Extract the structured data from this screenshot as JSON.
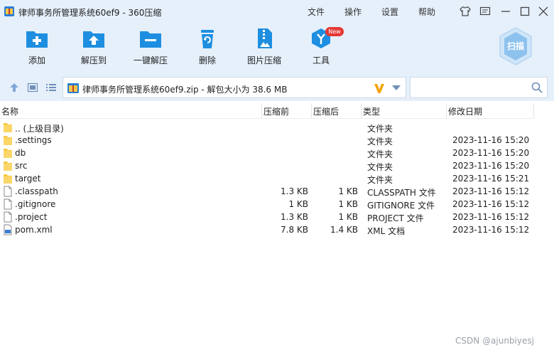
{
  "window": {
    "title": "律师事务所管理系统60ef9 - 360压缩",
    "menu": [
      "文件",
      "操作",
      "设置",
      "帮助"
    ]
  },
  "toolbar": {
    "items": [
      {
        "label": "添加",
        "icon": "add-icon"
      },
      {
        "label": "解压到",
        "icon": "extract-to-icon"
      },
      {
        "label": "一键解压",
        "icon": "one-click-extract-icon"
      },
      {
        "label": "删除",
        "icon": "delete-icon"
      },
      {
        "label": "图片压缩",
        "icon": "image-compress-icon"
      },
      {
        "label": "工具",
        "icon": "tools-icon"
      }
    ],
    "new_badge": "New",
    "scan_label": "扫描"
  },
  "address": {
    "path": "律师事务所管理系统60ef9.zip - 解包大小为 38.6 MB",
    "search_placeholder": ""
  },
  "columns": {
    "name": "名称",
    "compressed": "压缩前",
    "uncompressed": "压缩后",
    "type": "类型",
    "modified": "修改日期"
  },
  "files": [
    {
      "name": ".. (上级目录)",
      "kind": "folder",
      "compressed": "",
      "uncompressed": "",
      "type": "文件夹",
      "modified": ""
    },
    {
      "name": ".settings",
      "kind": "folder",
      "compressed": "",
      "uncompressed": "",
      "type": "文件夹",
      "modified": "2023-11-16 15:20"
    },
    {
      "name": "db",
      "kind": "folder",
      "compressed": "",
      "uncompressed": "",
      "type": "文件夹",
      "modified": "2023-11-16 15:20"
    },
    {
      "name": "src",
      "kind": "folder",
      "compressed": "",
      "uncompressed": "",
      "type": "文件夹",
      "modified": "2023-11-16 15:20"
    },
    {
      "name": "target",
      "kind": "folder",
      "compressed": "",
      "uncompressed": "",
      "type": "文件夹",
      "modified": "2023-11-16 15:21"
    },
    {
      "name": ".classpath",
      "kind": "file",
      "compressed": "1.3 KB",
      "uncompressed": "1 KB",
      "type": "CLASSPATH 文件",
      "modified": "2023-11-16 15:12"
    },
    {
      "name": ".gitignore",
      "kind": "file",
      "compressed": "1 KB",
      "uncompressed": "1 KB",
      "type": "GITIGNORE 文件",
      "modified": "2023-11-16 15:12"
    },
    {
      "name": ".project",
      "kind": "file",
      "compressed": "1.3 KB",
      "uncompressed": "1 KB",
      "type": "PROJECT 文件",
      "modified": "2023-11-16 15:12"
    },
    {
      "name": "pom.xml",
      "kind": "xml",
      "compressed": "7.8 KB",
      "uncompressed": "1.4 KB",
      "type": "XML 文档",
      "modified": "2023-11-16 15:12"
    }
  ],
  "watermark": "CSDN @ajunbiyesj",
  "colors": {
    "chrome_bg": "#e6f0fb",
    "icon_blue": "#1e8fe0",
    "folder_yellow": "#f7c948",
    "badge_red": "#e53935",
    "v_orange": "#f4a300"
  }
}
